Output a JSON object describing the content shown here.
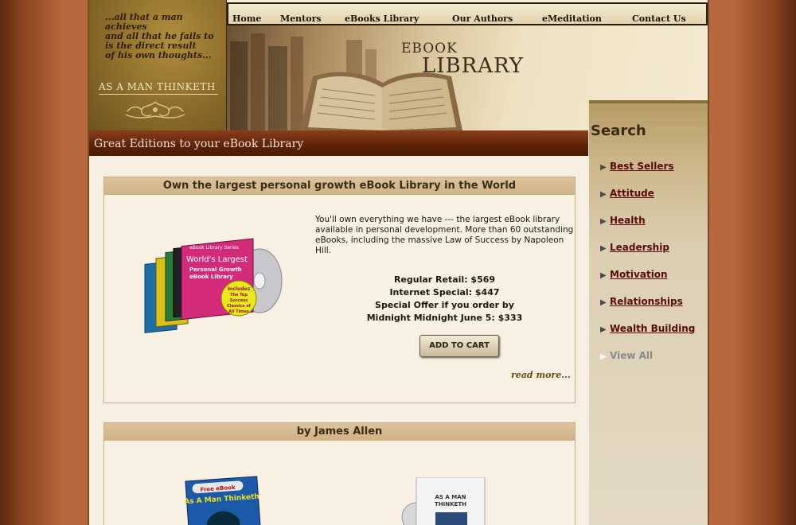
{
  "quote": {
    "text": "...all that a man achieves\nand all that he fails to\nis the direct result\nof his own thoughts...",
    "brand": "AS A MAN THINKETH"
  },
  "nav": {
    "items": [
      "Home",
      "Mentors",
      "eBooks Library",
      "Our Authors",
      "eMeditation",
      "Contact Us"
    ]
  },
  "header": {
    "title_line1": "EBOOK",
    "title_line2": "LIBRARY"
  },
  "banner": {
    "text": "Great Editions to your eBook Library"
  },
  "sidebar": {
    "title": "Search",
    "links": [
      "Best Sellers",
      "Attitude",
      "Health",
      "Leadership",
      "Motivation",
      "Relationships",
      "Wealth Building",
      "View All"
    ]
  },
  "box1": {
    "heading": "Own the largest personal growth eBook Library in the World",
    "description": "You'll own everything we have --- the largest eBook library available in personal development. More than 60 outstanding eBooks, including the massive Law of Success by Napoleon Hill.",
    "retail": "Regular Retail: $569",
    "internet": "Internet Special: $447",
    "offer_line1": "Special Offer if you order by",
    "offer_line2": "Midnight Midnight June 5: $333",
    "cart_label": "ADD TO CART",
    "read_more": "read more...",
    "product_series": "eBook Library Series",
    "product_title1": "World's Largest",
    "product_title2": "Personal Growth",
    "product_title3": "eBook Library",
    "badge_line1": "Includes",
    "badge_line2": "The Top",
    "badge_line3": "Success",
    "badge_line4": "Classics of",
    "badge_line5": "All Times"
  },
  "box2": {
    "heading": "by James Allen",
    "book1_tag": "Free eBook",
    "book1_title": "As A Man Thinketh",
    "book2_title_line1": "AS A MAN",
    "book2_title_line2": "THINKETH"
  },
  "colors": {
    "banner": "#5c2208",
    "link": "#5a0a0a",
    "page_bg": "#f6efe1"
  }
}
